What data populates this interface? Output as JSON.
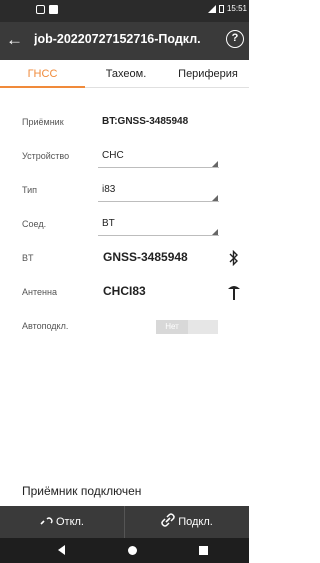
{
  "status_bar": {
    "time": "15:51"
  },
  "app_bar": {
    "back_icon": "arrow-left-icon",
    "title": "job-20220727152716-Подкл.",
    "help_icon": "help-circle-icon",
    "help_glyph": "?"
  },
  "tabs": [
    {
      "label": "ГНСС",
      "active": true
    },
    {
      "label": "Тахеом.",
      "active": false
    },
    {
      "label": "Периферия",
      "active": false
    }
  ],
  "fields": {
    "receiver": {
      "label": "Приёмник",
      "value": "BT:GNSS-3485948"
    },
    "device": {
      "label": "Устройство",
      "value": "CHC"
    },
    "type": {
      "label": "Тип",
      "value": "i83"
    },
    "connection": {
      "label": "Соед.",
      "value": "BT"
    },
    "bt": {
      "label": "BT",
      "value": "GNSS-3485948",
      "icon": "bluetooth-icon"
    },
    "antenna": {
      "label": "Антенна",
      "value": "CHCI83",
      "icon": "antenna-icon"
    },
    "autoconnect": {
      "label": "Автоподкл.",
      "toggle_text": "Нет"
    }
  },
  "status_message": "Приёмник подключен",
  "bottom_buttons": {
    "disconnect": {
      "label": "Откл.",
      "icon": "disconnect-link-icon"
    },
    "connect": {
      "label": "Подкл.",
      "icon": "link-icon"
    }
  },
  "colors": {
    "accent": "#f08a3a",
    "bar": "#3a3a3a",
    "status_bar": "#2b2b2b",
    "nav_bar": "#1e1e1e"
  }
}
